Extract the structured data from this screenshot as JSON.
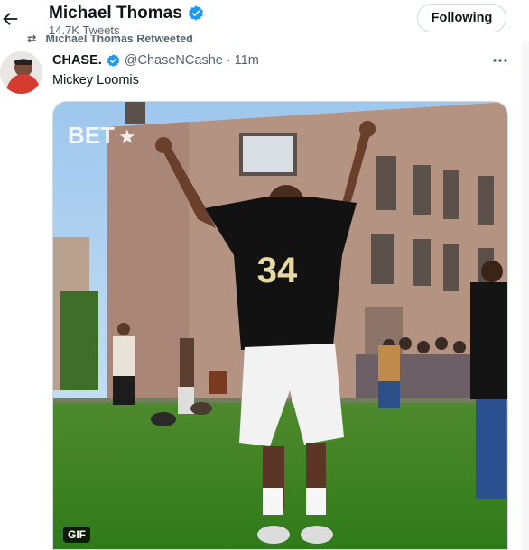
{
  "header": {
    "title": "Michael Thomas",
    "subtitle": "14.7K Tweets",
    "follow_label": "Following"
  },
  "retweet": {
    "text": "Michael Thomas Retweeted"
  },
  "tweet": {
    "name": "CHASE.",
    "handle": "@ChaseNCashe",
    "separator": "·",
    "time": "11m",
    "text": "Mickey Loomis",
    "media_watermark": "BET",
    "jersey_number": "34",
    "gif_label": "GIF"
  },
  "colors": {
    "verified": "#1d9bf0",
    "secondary_text": "#536471",
    "border": "#cfd9de"
  }
}
